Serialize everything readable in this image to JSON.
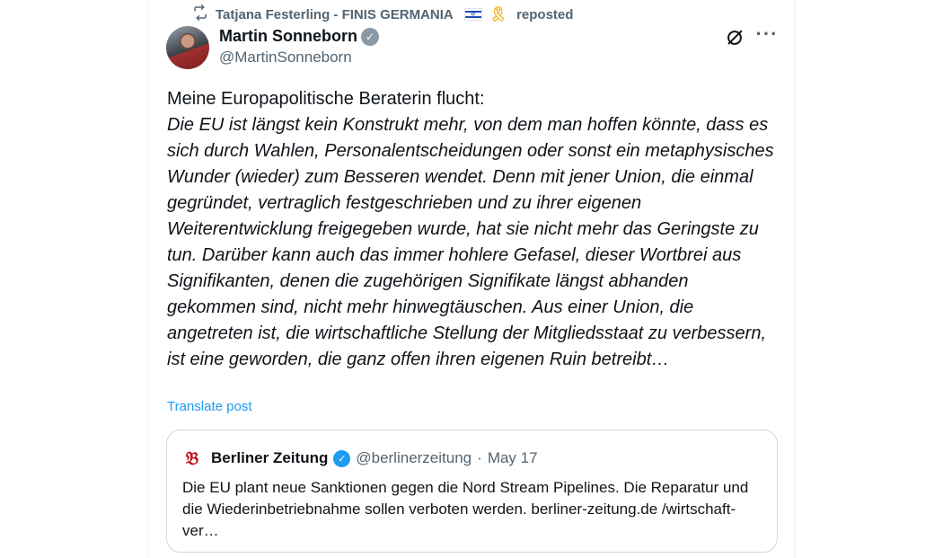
{
  "repost": {
    "user": "Tatjana Festerling - FINIS GERMANIA",
    "action": "reposted"
  },
  "author": {
    "name": "Martin Sonneborn",
    "handle": "@MartinSonneborn"
  },
  "post": {
    "intro": "Meine Europapolitische Beraterin flucht:",
    "quote": "Die EU ist längst kein Konstrukt mehr, von dem man hoffen könnte, dass es sich durch Wahlen, Personalentscheidungen oder sonst ein metaphysisches Wunder (wieder) zum Besseren wendet. Denn mit jener Union, die einmal gegründet, vertraglich festgeschrieben und zu ihrer eigenen Weiterentwicklung freigegeben wurde, hat sie nicht mehr das Geringste zu tun. Darüber kann auch das immer hohlere Gefasel, dieser Wortbrei aus Signifikanten, denen die zugehörigen Signifikate längst abhanden gekommen sind, nicht mehr hinwegtäuschen. Aus einer Union, die angetreten ist, die wirtschaftliche Stellung der Mitgliedsstaat zu verbessern, ist eine geworden, die ganz offen ihren eigenen Ruin betreibt…",
    "translate_label": "Translate post"
  },
  "quoted": {
    "logo": "𝔅",
    "name": "Berliner Zeitung",
    "handle": "@berlinerzeitung",
    "separator": "·",
    "date": "May 17",
    "text": "Die EU plant neue Sanktionen gegen die Nord Stream Pipelines. Die Reparatur und die Wiederinbetriebnahme sollen verboten werden. berliner-zeitung.de /wirtschaft-ver…"
  },
  "icons": {
    "repost": "repost-icon",
    "flag": "israel-flag-icon",
    "ribbon": "yellow-ribbon-icon",
    "verified": "verified-badge-icon",
    "grok": "grok-icon",
    "more": "more-icon"
  },
  "colors": {
    "accent": "#1d9bf0",
    "muted": "#536471",
    "text": "#0f1419",
    "border": "#cfd9de"
  }
}
